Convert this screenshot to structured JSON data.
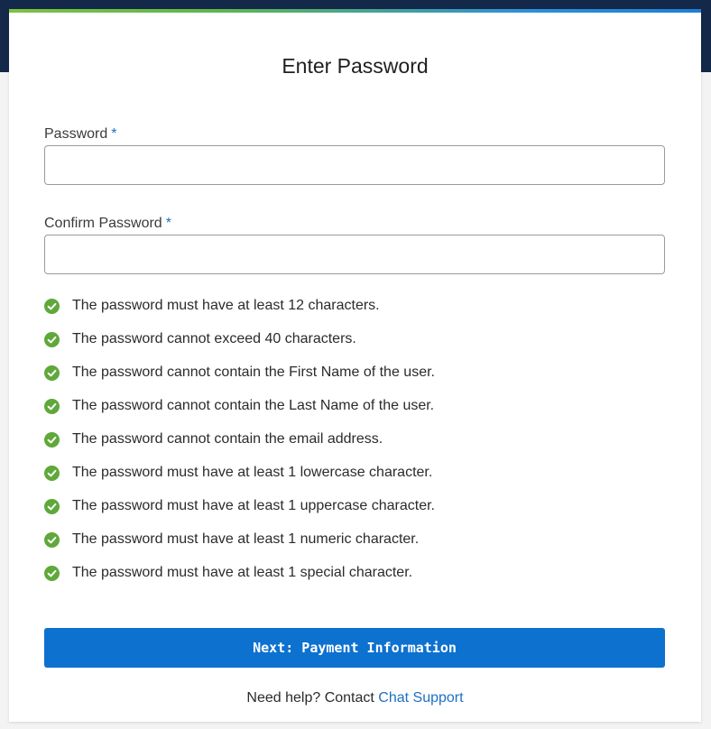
{
  "colors": {
    "header_band": "#14284a",
    "accent_green": "#7dc242",
    "accent_blue": "#2f8fd8",
    "button_bg": "#0d71d0",
    "link": "#1f6fc5",
    "check_green": "#5fa83a"
  },
  "page": {
    "title": "Enter Password"
  },
  "form": {
    "password": {
      "label": "Password",
      "required_mark": "*",
      "value": "",
      "placeholder": ""
    },
    "confirm_password": {
      "label": "Confirm Password",
      "required_mark": "*",
      "value": "",
      "placeholder": ""
    }
  },
  "rules": [
    {
      "icon": "check-circle-icon",
      "text": "The password must have at least 12 characters."
    },
    {
      "icon": "check-circle-icon",
      "text": "The password cannot exceed 40 characters."
    },
    {
      "icon": "check-circle-icon",
      "text": "The password cannot contain the First Name of the user."
    },
    {
      "icon": "check-circle-icon",
      "text": "The password cannot contain the Last Name of the user."
    },
    {
      "icon": "check-circle-icon",
      "text": "The password cannot contain the email address."
    },
    {
      "icon": "check-circle-icon",
      "text": "The password must have at least 1 lowercase character."
    },
    {
      "icon": "check-circle-icon",
      "text": "The password must have at least 1 uppercase character."
    },
    {
      "icon": "check-circle-icon",
      "text": "The password must have at least 1 numeric character."
    },
    {
      "icon": "check-circle-icon",
      "text": "The password must have at least 1 special character."
    }
  ],
  "actions": {
    "next_label": "Next: Payment Information"
  },
  "help": {
    "prefix": "Need help? Contact",
    "link_label": "Chat Support"
  }
}
